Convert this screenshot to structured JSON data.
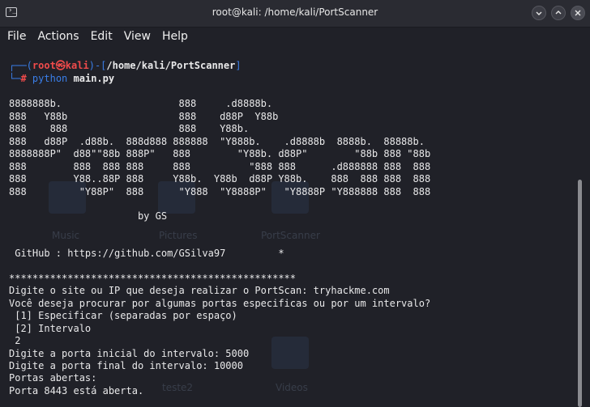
{
  "window": {
    "title": "root@kali: /home/kali/PortScanner",
    "title_icon_glyph": "›_",
    "controls": [
      "minimize",
      "maximize",
      "close"
    ]
  },
  "menu": [
    "File",
    "Actions",
    "Edit",
    "View",
    "Help"
  ],
  "desktop_ghost_labels": {
    "music": "Music",
    "pictures": "Pictures",
    "portscanner": "PortScanner",
    "teste2": "teste2",
    "videos": "Videos"
  },
  "terminal": {
    "prompt": {
      "top_left": "┌──(",
      "user": "root㉿kali",
      "mid": ")-[",
      "path": "/home/kali/PortScanner",
      "end": "]",
      "bottom_left": "└─",
      "hash": "#",
      "cmd": "python",
      "arg": "main.py"
    },
    "banner": [
      "8888888b.                    888     .d8888b.",
      "888   Y88b                   888    d88P  Y88b",
      "888    888                   888    Y88b.",
      "888   d88P  .d88b.  888d888 888888  \"Y888b.    .d8888b  8888b.  88888b.",
      "8888888P\"  d88\"\"88b 888P\"   888        \"Y88b. d88P\"        \"88b 888 \"88b",
      "888        888  888 888     888          \"888 888      .d888888 888  888",
      "888        Y88..88P 888     Y88b.  Y88b  d88P Y88b.    888  888 888  888",
      "888         \"Y88P\"  888      \"Y888  \"Y8888P\"   \"Y8888P \"Y888888 888  888"
    ],
    "byline": "                      by GS",
    "github": " GitHub : https://github.com/GSilva97         *",
    "output": [
      "*************************************************",
      "Digite o site ou IP que deseja realizar o PortScan: tryhackme.com",
      "Você deseja procurar por algumas portas especificas ou por um intervalo?",
      " [1] Especificar (separadas por espaço)",
      " [2] Intervalo",
      " 2",
      "Digite a porta inicial do intervalo: 5000",
      "Digite a porta final do intervalo: 10000",
      "Portas abertas:",
      "Porta 8443 está aberta."
    ]
  },
  "colors": {
    "background": "#202128",
    "titlebar": "#2a2b32",
    "text": "#e9e9ea",
    "prompt_blue": "#3a7ee8",
    "prompt_red": "#f04b4b",
    "scroll_thumb": "#8a8b90"
  }
}
